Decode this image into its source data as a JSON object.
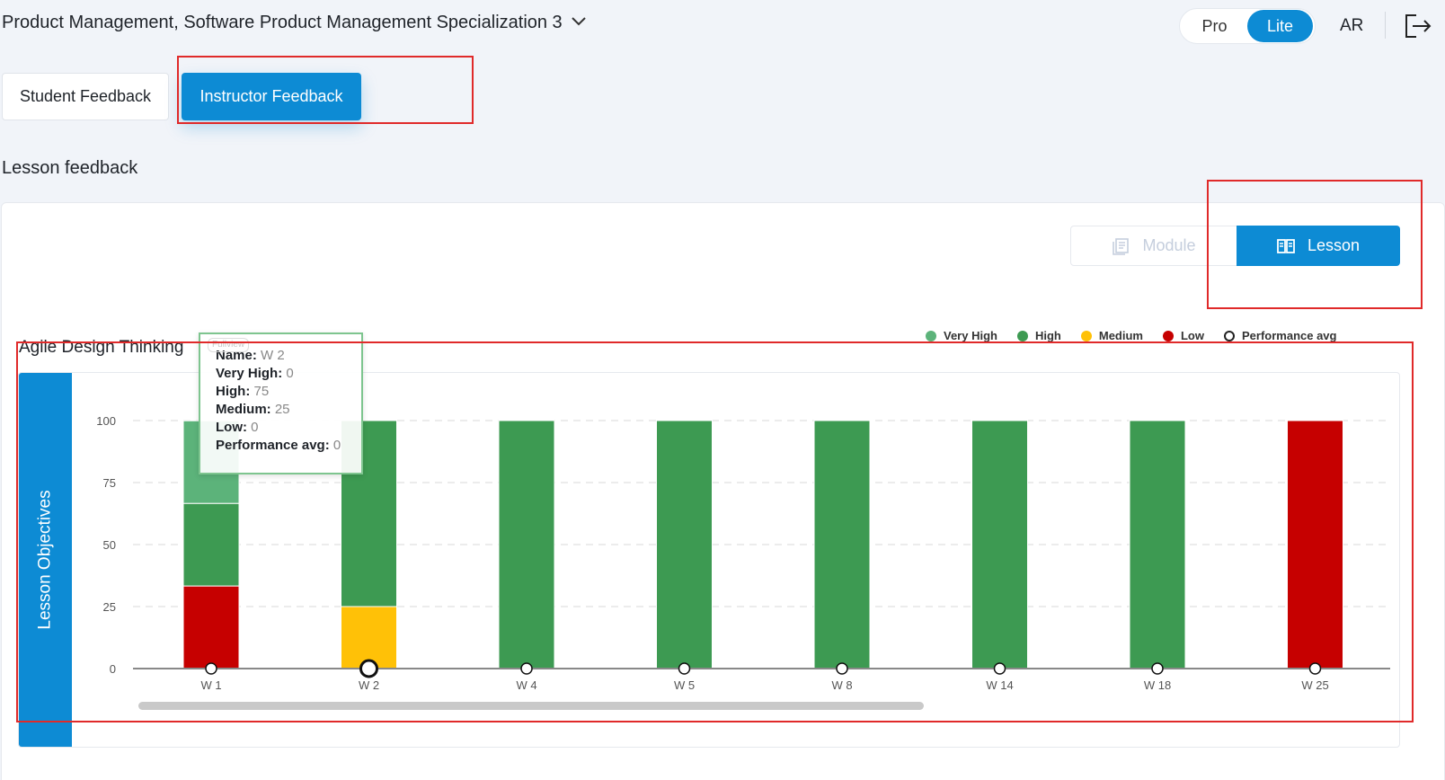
{
  "header": {
    "course_title": "Product Management, Software Product Management Specialization 3",
    "plan_options": [
      "Pro",
      "Lite"
    ],
    "active_plan": "Lite",
    "language": "AR"
  },
  "tabs": [
    {
      "label": "Student Feedback",
      "active": false
    },
    {
      "label": "Instructor Feedback",
      "active": true
    }
  ],
  "section_title": "Lesson feedback",
  "view_toggle": {
    "module_label": "Module",
    "lesson_label": "Lesson",
    "active": "Lesson"
  },
  "colors": {
    "accent": "#0d8bd4",
    "very_high": "#5cb37a",
    "high": "#3d9a52",
    "medium": "#ffc107",
    "low": "#c60000"
  },
  "tooltip": {
    "badge": "Fullview",
    "name_label": "Name:",
    "name_value": "W 2",
    "very_high_label": "Very High:",
    "very_high_value": "0",
    "high_label": "High:",
    "high_value": "75",
    "medium_label": "Medium:",
    "medium_value": "25",
    "low_label": "Low:",
    "low_value": "0",
    "perf_label": "Performance avg:",
    "perf_value": "0"
  },
  "chart_data": {
    "type": "bar",
    "stacked": true,
    "title": "Agile Design Thinking",
    "ylabel": "Lesson Objectives",
    "xlabel": "",
    "ylim": [
      0,
      100
    ],
    "yticks": [
      0,
      25,
      50,
      75,
      100
    ],
    "grid": true,
    "legend_position": "top-right",
    "categories": [
      "W 1",
      "W 2",
      "W 4",
      "W 5",
      "W 8",
      "W 14",
      "W 18",
      "W 25"
    ],
    "series": [
      {
        "name": "Low",
        "color": "#c60000",
        "values": [
          33.3,
          0,
          0,
          0,
          0,
          0,
          0,
          100
        ]
      },
      {
        "name": "Medium",
        "color": "#ffc107",
        "values": [
          0,
          25,
          0,
          0,
          0,
          0,
          0,
          0
        ]
      },
      {
        "name": "High",
        "color": "#3d9a52",
        "values": [
          33.3,
          75,
          100,
          100,
          100,
          100,
          100,
          0
        ]
      },
      {
        "name": "Very High",
        "color": "#5cb37a",
        "values": [
          33.3,
          0,
          0,
          0,
          0,
          0,
          0,
          0
        ]
      }
    ],
    "performance_avg": {
      "name": "Performance avg",
      "values": [
        0,
        0,
        0,
        0,
        0,
        0,
        0,
        0
      ]
    },
    "highlighted_category": "W 2"
  }
}
